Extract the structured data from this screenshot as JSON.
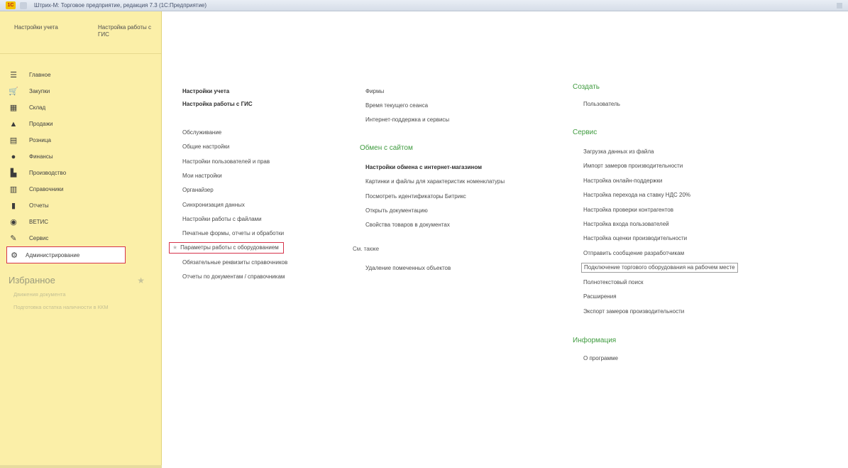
{
  "window": {
    "title": "Штрих-М: Торговое предприятие, редакция 7.3  (1С:Предприятие)",
    "logo_text": "1С"
  },
  "sidebar": {
    "top_links": [
      "Настройки учета",
      "Настройка работы с ГИС"
    ],
    "sections": [
      {
        "label": "Главное",
        "icon": "☰"
      },
      {
        "label": "Закупки",
        "icon": "🛒"
      },
      {
        "label": "Склад",
        "icon": "▦"
      },
      {
        "label": "Продажи",
        "icon": "▲"
      },
      {
        "label": "Розница",
        "icon": "▤"
      },
      {
        "label": "Финансы",
        "icon": "●"
      },
      {
        "label": "Производство",
        "icon": "▙"
      },
      {
        "label": "Справочники",
        "icon": "▥"
      },
      {
        "label": "Отчеты",
        "icon": "▮"
      },
      {
        "label": "ВЕТИС",
        "icon": "◉"
      },
      {
        "label": "Сервис",
        "icon": "✎"
      },
      {
        "label": "Администрирование",
        "icon": "⚙"
      }
    ],
    "favorites": {
      "title": "Избранное",
      "items": [
        "Движения документа",
        "Подготовка остатка наличности в ККМ"
      ]
    }
  },
  "main": {
    "col1": {
      "bold_links": [
        "Настройки учета",
        "Настройка работы с ГИС"
      ],
      "links": [
        "Обслуживание",
        "Общие настройки",
        "Настройки пользователей и прав",
        "Мои настройки",
        "Органайзер",
        "Синхронизация данных",
        "Настройки работы с файлами",
        "Печатные формы, отчеты и обработки",
        "Параметры работы с оборудованием",
        "Обязательные реквизиты справочников",
        "Отчеты по документам / справочникам"
      ]
    },
    "col2": {
      "links_top": [
        "Фирмы",
        "Время текущего сеанса",
        "Интернет-поддержка и сервисы"
      ],
      "exchange_title": "Обмен с сайтом",
      "exchange_bold": "Настройки обмена с интернет-магазином",
      "exchange_links": [
        "Картинки и файлы для характеристик номенклатуры",
        "Посмотреть идентификаторы Битрикс",
        "Открыть документацию",
        "Свойства товаров в документах"
      ],
      "see_also_title": "См. также",
      "see_also_links": [
        "Удаление помеченных объектов"
      ]
    },
    "col3": {
      "create_title": "Создать",
      "create_links": [
        "Пользователь"
      ],
      "service_title": "Сервис",
      "service_links": [
        "Загрузка данных из файла",
        "Импорт замеров производительности",
        "Настройка онлайн-поддержки",
        "Настройка перехода на ставку НДС 20%",
        "Настройка проверки контрагентов",
        "Настройка входа пользователей",
        "Настройка оценки производительности",
        "Отправить сообщение разработчикам",
        "Подключение торгового оборудования на рабочем месте",
        "Полнотекстовый поиск",
        "Расширения",
        "Экспорт замеров производительности"
      ],
      "info_title": "Информация",
      "info_links": [
        "О программе"
      ]
    }
  }
}
